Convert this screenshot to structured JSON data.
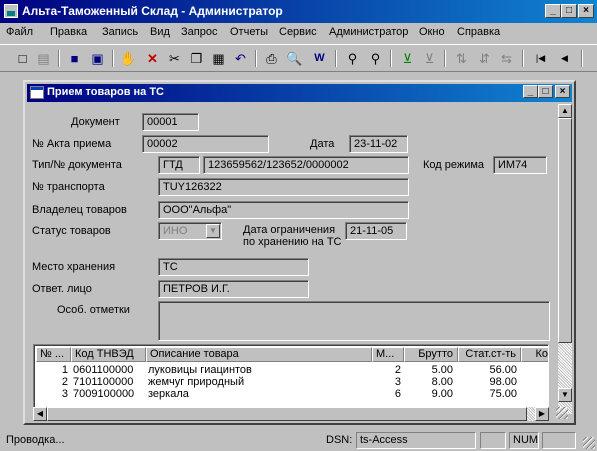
{
  "app": {
    "title": "Альта-Таможенный Склад - Администратор"
  },
  "menu": [
    "Файл",
    "Правка",
    "Запись",
    "Вид",
    "Запрос",
    "Отчеты",
    "Сервис",
    "Администратор",
    "Окно",
    "Справка"
  ],
  "window_buttons": {
    "minimize": "_",
    "maximize": "□",
    "close": "×"
  },
  "toolbar_icons": [
    "new-icon",
    "copy-doc-icon",
    "save-icon",
    "save-as-icon",
    "hand-icon",
    "delete-icon",
    "cut-icon",
    "copy-icon",
    "paste-icon",
    "undo-icon",
    "print-icon",
    "print-preview-icon",
    "word-export-icon",
    "find-icon",
    "find-next-icon",
    "filter-icon",
    "filter-off-icon",
    "sort-asc-icon",
    "sort-desc-icon",
    "sort-clear-icon",
    "first-record-icon",
    "prev-record-icon"
  ],
  "child": {
    "title": "Прием товаров на ТС",
    "form": {
      "document_label": "Документ",
      "document_value": "00001",
      "act_label": "№ Акта приема",
      "act_value": "00002",
      "date_label": "Дата",
      "date_value": "23-11-02",
      "doc_type_label": "Тип/№ документа",
      "doc_type_value": "ГТД",
      "doc_number_value": "123659562/123652/0000002",
      "mode_label": "Код режима",
      "mode_value": "ИМ74",
      "transport_label": "№ транспорта",
      "transport_value": "TUY126322",
      "owner_label": "Владелец товаров",
      "owner_value": "ООО\"Альфа\"",
      "status_label": "Статус товаров",
      "status_value": "ИНО",
      "limit_label_1": "Дата ограничения",
      "limit_label_2": "по хранению на ТС",
      "limit_value": "21-11-05",
      "storage_label": "Место хранения",
      "storage_value": "ТС",
      "responsible_label": "Ответ. лицо",
      "responsible_value": "ПЕТРОВ И.Г.",
      "notes_label": "Особ. отметки",
      "notes_value": ""
    },
    "table": {
      "columns": [
        "№ ...",
        "Код ТНВЭД",
        "Описание товара",
        "М...",
        "Брутто",
        "Стат.ст-ть",
        "Ко"
      ],
      "rows": [
        {
          "n": "1",
          "code": "0601100000",
          "desc": "луковицы гиацинтов",
          "m": "2",
          "gross": "5.00",
          "value": "56.00"
        },
        {
          "n": "2",
          "code": "7101100000",
          "desc": "жемчуг природный",
          "m": "3",
          "gross": "8.00",
          "value": "98.00"
        },
        {
          "n": "3",
          "code": "7009100000",
          "desc": "зеркала",
          "m": "6",
          "gross": "9.00",
          "value": "75.00"
        }
      ]
    }
  },
  "status": {
    "message": "Проводка...",
    "dsn_label": "DSN:",
    "dsn_value": "ts-Access",
    "num": "NUM"
  }
}
